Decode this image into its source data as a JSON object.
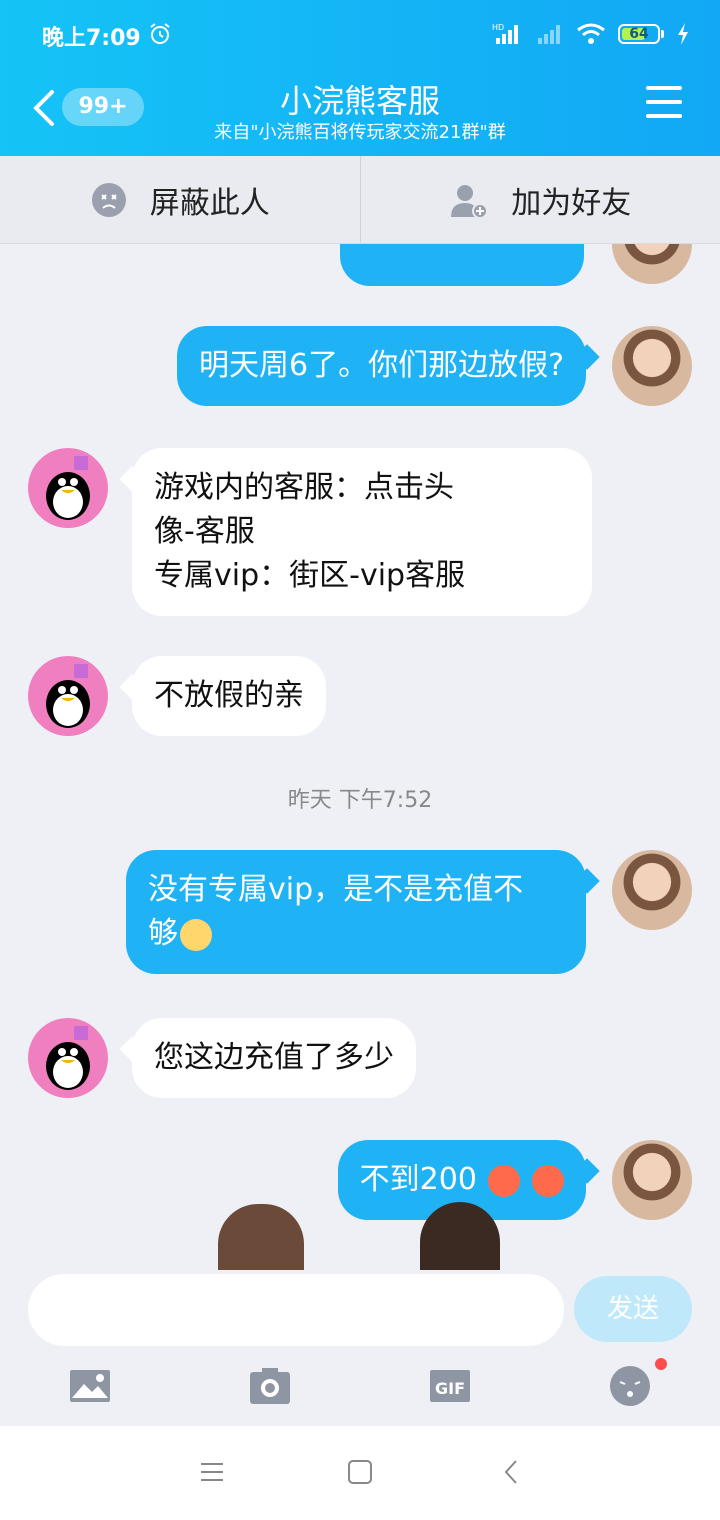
{
  "status": {
    "time": "晚上7:09",
    "signal1": "HD",
    "battery": "64"
  },
  "header": {
    "badge": "99+",
    "title": "小浣熊客服",
    "subtitle": "来自\"小浣熊百将传玩家交流21群\"群"
  },
  "actions": {
    "block": "屏蔽此人",
    "add_friend": "加为好友"
  },
  "messages": [
    {
      "from": "me",
      "text": "明天周6了。你们那边放假?"
    },
    {
      "from": "them",
      "lines": [
        "游戏内的客服：点击头",
        "像-客服",
        "专属vip：街区-vip客服"
      ]
    },
    {
      "from": "them",
      "text": "不放假的亲"
    },
    {
      "from": "me",
      "lines": [
        "没有专属vip，是不是充值不",
        "够"
      ]
    },
    {
      "from": "them",
      "text": "您这边充值了多少"
    },
    {
      "from": "me",
      "text": "不到200"
    }
  ],
  "timestamp": "昨天 下午7:52",
  "input": {
    "send_label": "发送"
  },
  "tools": {
    "gif": "GIF"
  },
  "colors": {
    "brand": "#12a8f5",
    "bubble_me": "#1fb3f5",
    "badge_dot": "#ff4d4f"
  }
}
